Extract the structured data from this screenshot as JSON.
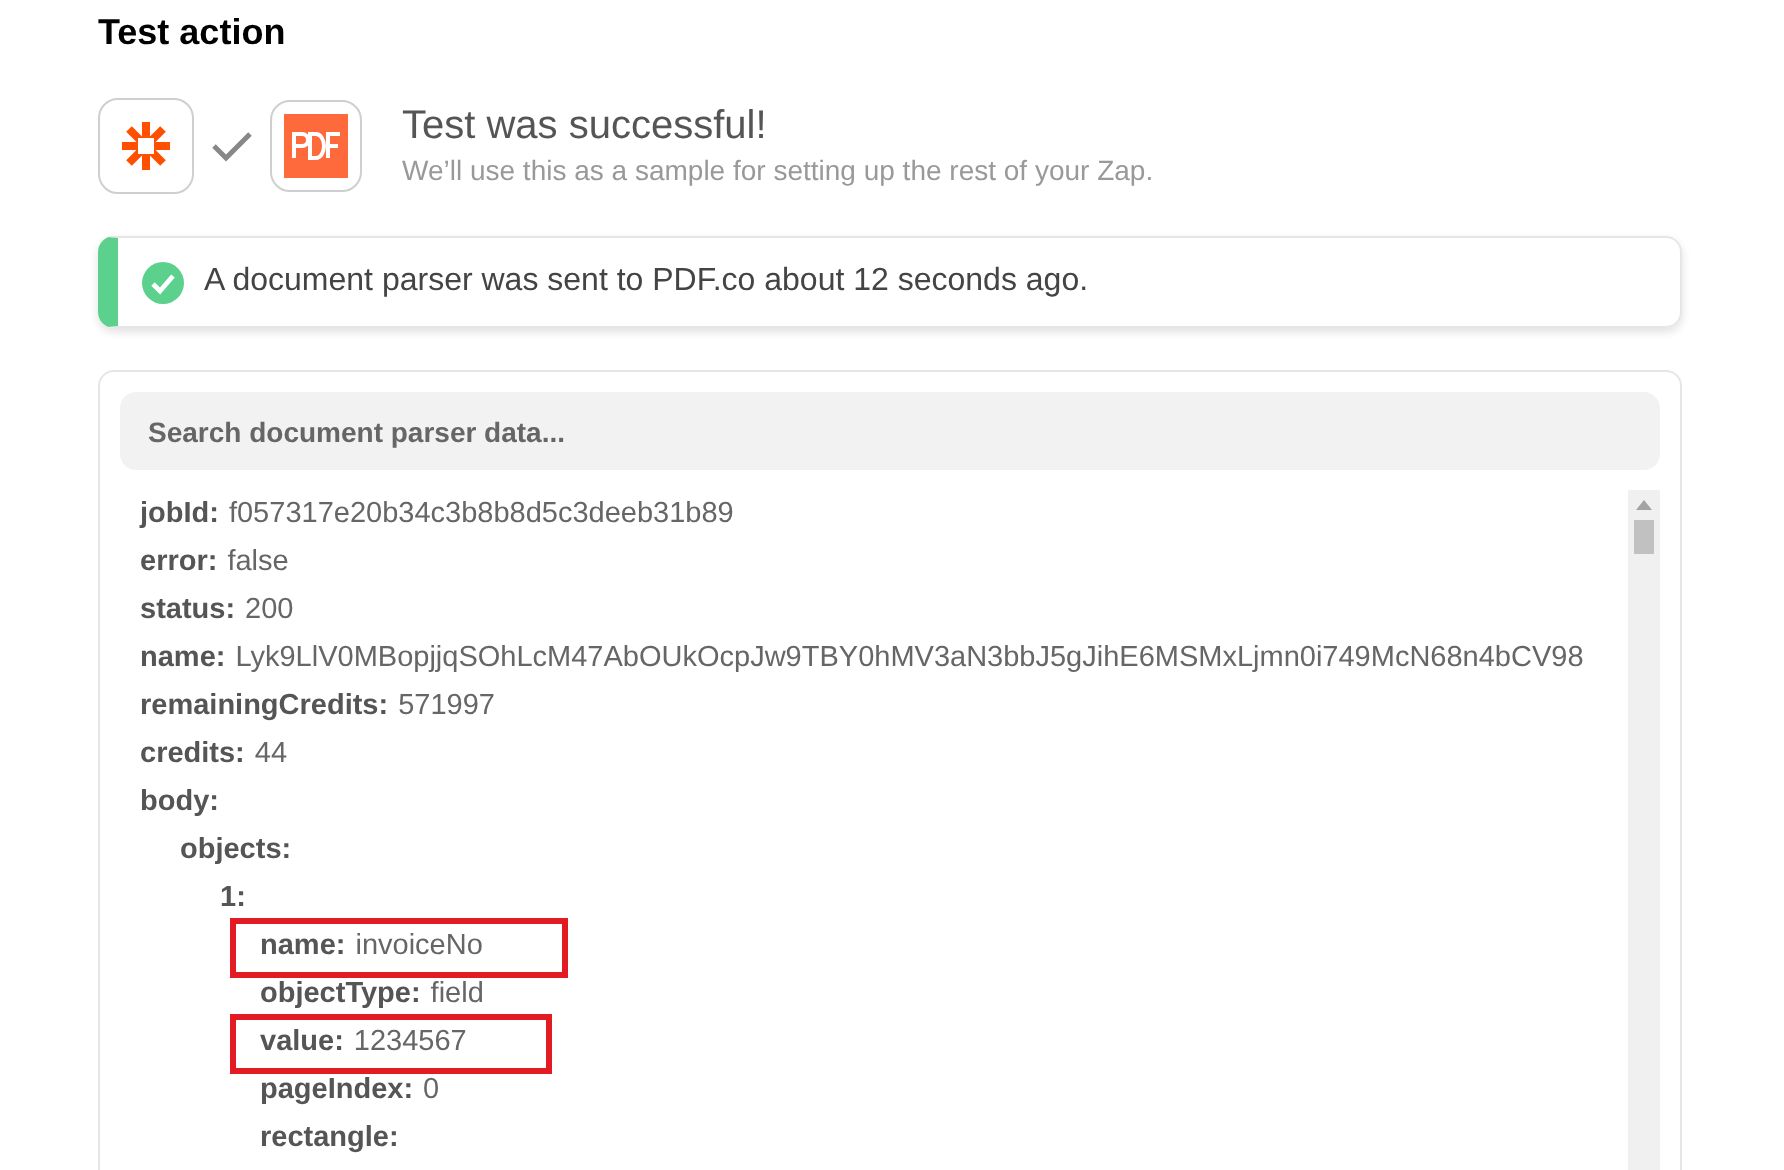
{
  "section_title": "Test action",
  "result": {
    "title": "Test was successful!",
    "subtitle": "We’ll use this as a sample for setting up the rest of your Zap."
  },
  "alert": {
    "message": "A document parser was sent to PDF.co about 12 seconds ago."
  },
  "search": {
    "placeholder": "Search document parser data..."
  },
  "tree": [
    {
      "key": "jobId:",
      "value": "f057317e20b34c3b8b8d5c3deeb31b89",
      "highlighted": false
    },
    {
      "key": "error:",
      "value": "false",
      "highlighted": false
    },
    {
      "key": "status:",
      "value": "200",
      "highlighted": false
    },
    {
      "key": "name:",
      "value": "Lyk9LlV0MBopjjqSOhLcM47AbOUkOcpJw9TBY0hMV3aN3bbJ5gJihE6MSMxLjmn0i749McN68n4bCV98",
      "highlighted": false
    },
    {
      "key": "remainingCredits:",
      "value": "571997",
      "highlighted": false
    },
    {
      "key": "credits:",
      "value": "44",
      "highlighted": false
    },
    {
      "key": "body:",
      "highlighted": false,
      "children": [
        {
          "key": "objects:",
          "highlighted": false,
          "children": [
            {
              "key": "1:",
              "highlighted": false,
              "children": [
                {
                  "key": "name:",
                  "value": "invoiceNo",
                  "highlighted": true
                },
                {
                  "key": "objectType:",
                  "value": "field",
                  "highlighted": false
                },
                {
                  "key": "value:",
                  "value": "1234567",
                  "highlighted": true
                },
                {
                  "key": "pageIndex:",
                  "value": "0",
                  "highlighted": false
                },
                {
                  "key": "rectangle:",
                  "highlighted": false
                }
              ]
            }
          ]
        }
      ]
    }
  ]
}
